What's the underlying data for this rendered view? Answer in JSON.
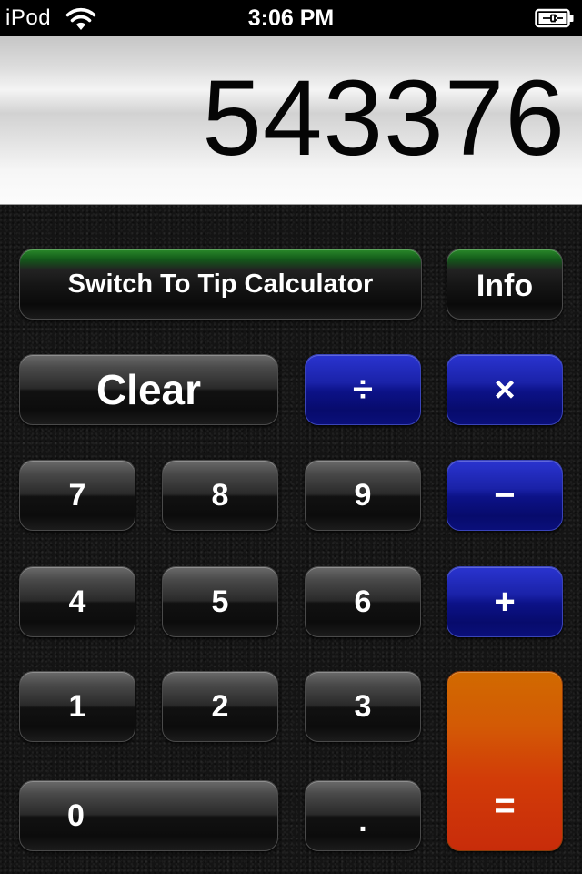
{
  "status_bar": {
    "carrier": "iPod",
    "time": "3:06 PM",
    "wifi_icon": "wifi-icon",
    "battery_icon": "battery-charging-icon"
  },
  "display": {
    "value": "543376"
  },
  "buttons": {
    "switch_mode": "Switch To Tip Calculator",
    "info": "Info",
    "clear": "Clear",
    "divide": "÷",
    "multiply": "×",
    "subtract": "−",
    "add": "+",
    "equals": "=",
    "decimal": ".",
    "digits": {
      "d0": "0",
      "d1": "1",
      "d2": "2",
      "d3": "3",
      "d4": "4",
      "d5": "5",
      "d6": "6",
      "d7": "7",
      "d8": "8",
      "d9": "9"
    }
  },
  "colors": {
    "operator_blue": "#0c1288",
    "equals_orange": "#d2450a",
    "mode_green": "#2a8a2a",
    "key_dark": "#1c1c1c"
  }
}
